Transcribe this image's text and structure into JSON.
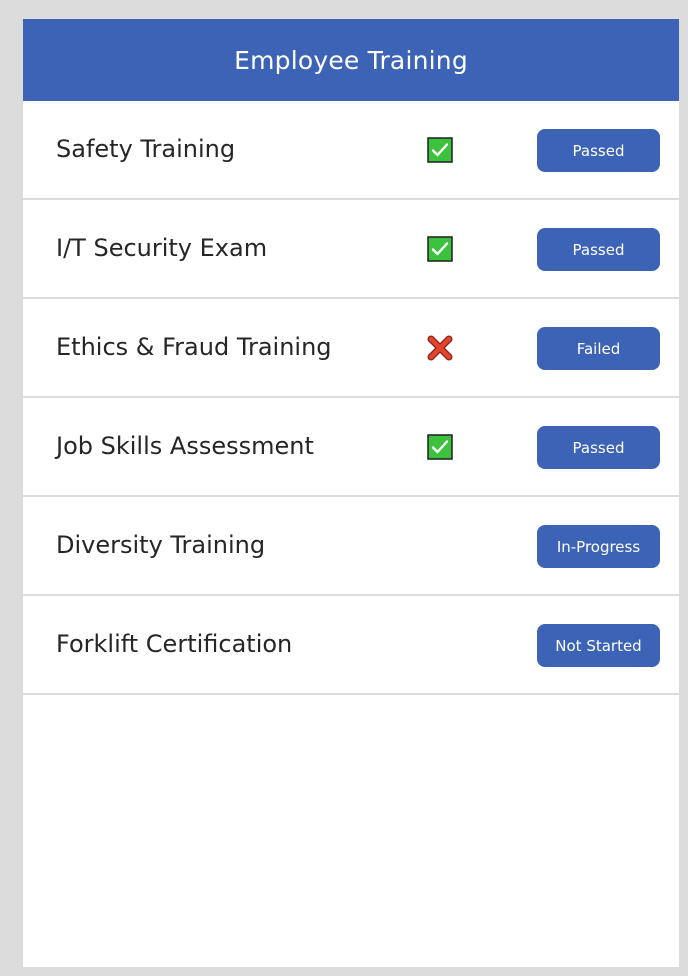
{
  "header": {
    "title": "Employee Training"
  },
  "colors": {
    "accent": "#3d63b7",
    "check_green": "#3cc23c",
    "fail_red": "#e0452f"
  },
  "trainings": [
    {
      "label": "Safety Training",
      "icon": "check-icon",
      "status": "Passed"
    },
    {
      "label": "I/T Security Exam",
      "icon": "check-icon",
      "status": "Passed"
    },
    {
      "label": "Ethics & Fraud Training",
      "icon": "cross-icon",
      "status": "Failed"
    },
    {
      "label": "Job Skills Assessment",
      "icon": "check-icon",
      "status": "Passed"
    },
    {
      "label": "Diversity Training",
      "icon": "none",
      "status": "In-Progress"
    },
    {
      "label": "Forklift Certification",
      "icon": "none",
      "status": "Not Started"
    }
  ]
}
